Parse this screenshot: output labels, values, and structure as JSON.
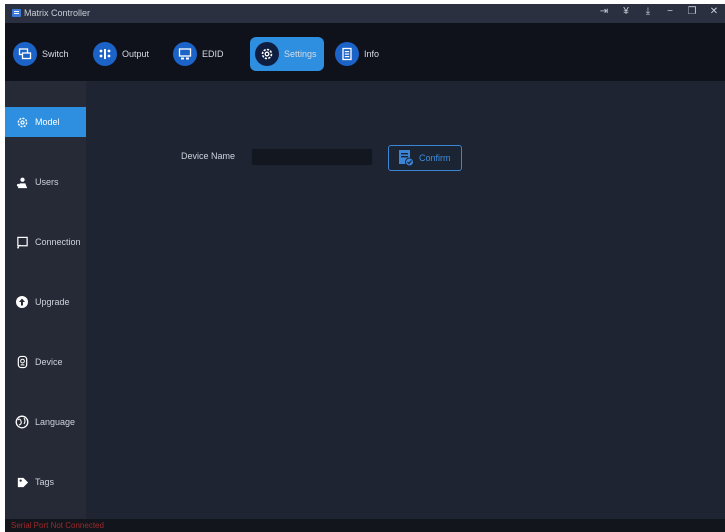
{
  "titlebar": {
    "title": "Matrix Controller",
    "controls": [
      "login-icon",
      "pin-icon",
      "download-icon",
      "minimize-icon",
      "restore-icon",
      "close-icon"
    ]
  },
  "nav": {
    "items": [
      {
        "label": "Switch",
        "icon": "switch-icon"
      },
      {
        "label": "Output",
        "icon": "output-icon"
      },
      {
        "label": "EDID",
        "icon": "edid-icon"
      },
      {
        "label": "Settings",
        "icon": "settings-icon",
        "active": true
      },
      {
        "label": "Info",
        "icon": "info-icon"
      }
    ]
  },
  "sidebar": {
    "items": [
      {
        "label": "Model",
        "icon": "gear-icon",
        "active": true
      },
      {
        "label": "Users",
        "icon": "users-icon"
      },
      {
        "label": "Connection",
        "icon": "connection-icon"
      },
      {
        "label": "Upgrade",
        "icon": "upgrade-icon"
      },
      {
        "label": "Device",
        "icon": "device-icon"
      },
      {
        "label": "Language",
        "icon": "language-icon"
      },
      {
        "label": "Tags",
        "icon": "tags-icon"
      }
    ]
  },
  "main": {
    "device_name_label": "Device Name",
    "device_name_value": "",
    "confirm_label": "Confirm"
  },
  "status": {
    "text": "Serial Port Not Connected"
  },
  "colors": {
    "accent": "#2e8fe0",
    "background": "#1e2432",
    "sidebar": "#252a36",
    "navbar": "#0f121a",
    "status_error": "#9b2a2a"
  }
}
